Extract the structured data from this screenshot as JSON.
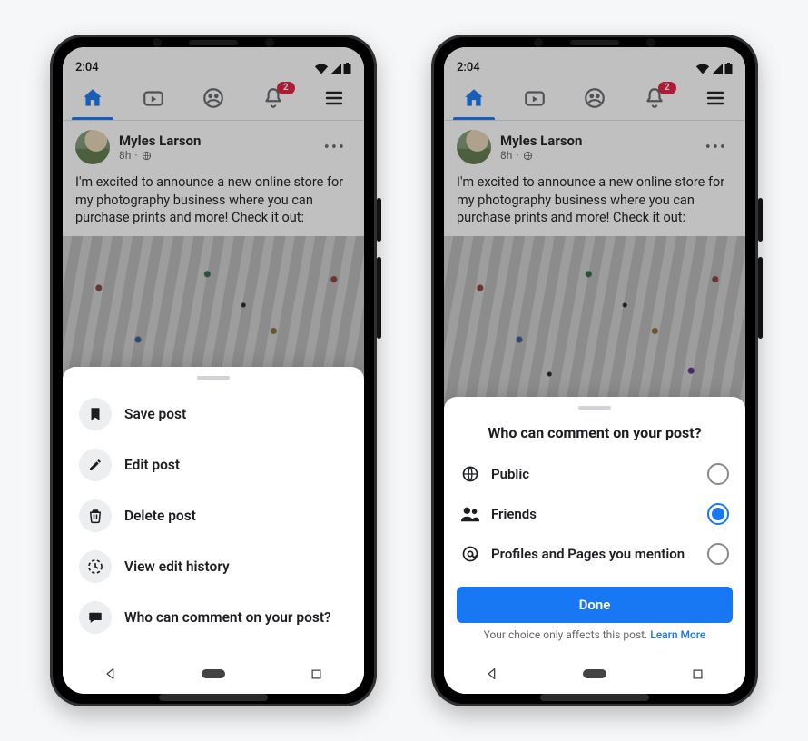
{
  "status": {
    "time": "2:04"
  },
  "tabs": {
    "notifications_badge": "2"
  },
  "post": {
    "author": "Myles Larson",
    "time": "8h",
    "text": "I'm excited to announce a new online store for my photography business where you can purchase prints and more! Check it out:"
  },
  "menu": {
    "save": "Save post",
    "edit": "Edit post",
    "delete": "Delete post",
    "history": "View edit history",
    "who_comment": "Who can comment on your post?"
  },
  "selector": {
    "title": "Who can comment on your post?",
    "options": {
      "public": "Public",
      "friends": "Friends",
      "mentions": "Profiles and Pages you mention"
    },
    "done_label": "Done",
    "footer_text": "Your choice only affects this post. ",
    "learn_more": "Learn More"
  }
}
